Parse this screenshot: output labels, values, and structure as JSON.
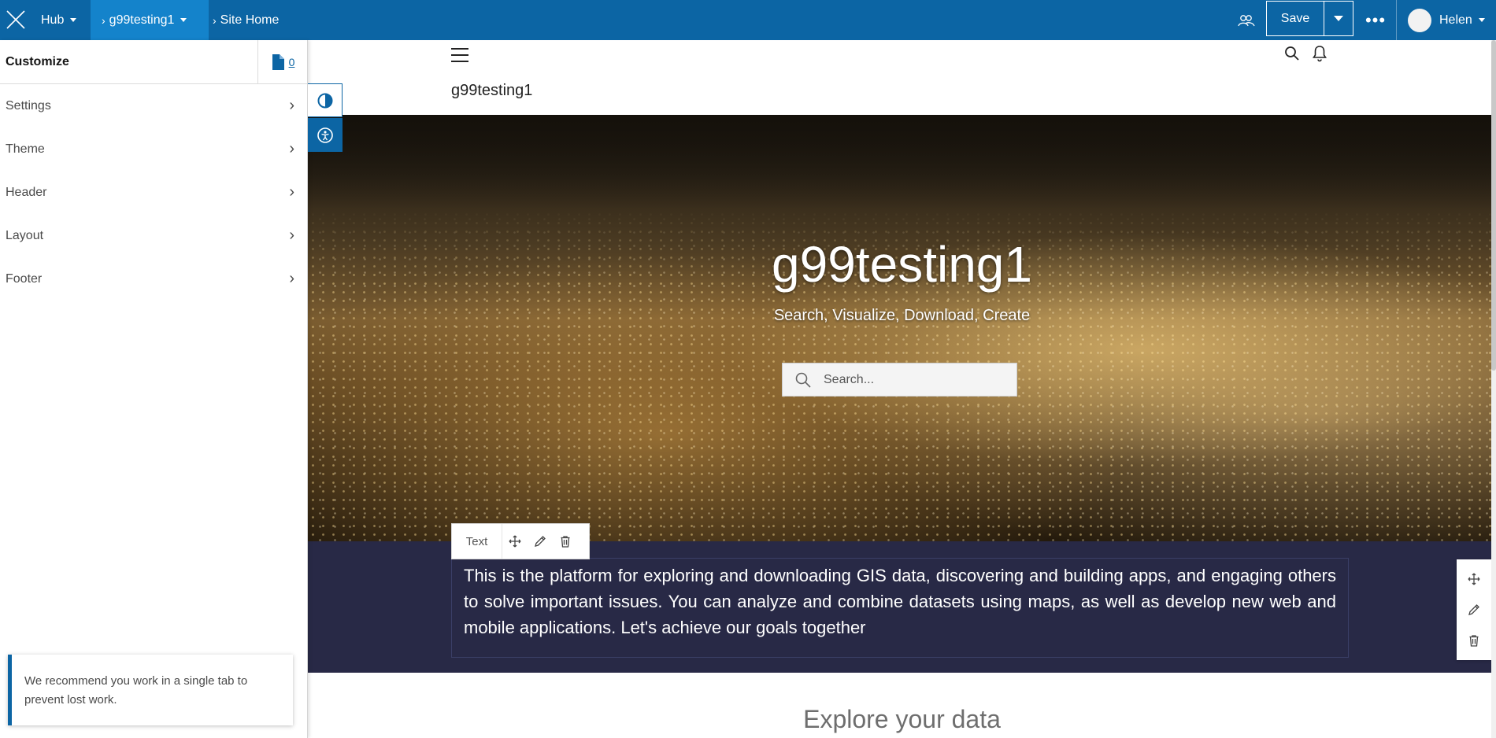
{
  "topbar": {
    "hub_label": "Hub",
    "site_label": "g99testing1",
    "page_label": "Site Home",
    "save_label": "Save",
    "more_label": "•••",
    "user_name": "Helen"
  },
  "customize": {
    "title": "Customize",
    "pages_count": "0",
    "items": [
      {
        "label": "Settings"
      },
      {
        "label": "Theme"
      },
      {
        "label": "Header"
      },
      {
        "label": "Layout"
      },
      {
        "label": "Footer"
      }
    ],
    "toast": "We recommend you work in a single tab to prevent lost work."
  },
  "site": {
    "name": "g99testing1",
    "hero_title": "g99testing1",
    "hero_subtitle": "Search, Visualize, Download, Create",
    "search_placeholder": "Search...",
    "text_card_label": "Text",
    "body_text": "This is the platform for exploring and downloading GIS data, discovering and building apps, and engaging others to solve important issues. You can analyze and combine datasets using maps, as well as develop new web and mobile applications. Let's achieve our goals together",
    "explore_heading": "Explore your data"
  },
  "colors": {
    "brand_blue": "#0c65a4",
    "active_tab_blue": "#1483cb",
    "text_band": "#282946"
  },
  "icons": [
    "close-icon",
    "collaborate-icon",
    "page-icon",
    "chevron-right-icon",
    "contrast-icon",
    "accessibility-icon",
    "menu-icon",
    "search-icon",
    "bell-icon",
    "move-icon",
    "pencil-icon",
    "trash-icon"
  ]
}
